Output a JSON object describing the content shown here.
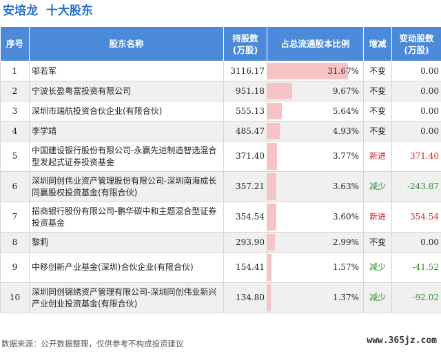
{
  "header": {
    "company": "安培龙",
    "subtitle": "十大股东"
  },
  "columns": {
    "index": "序号",
    "name": "股东名称",
    "shares_l1": "持股数",
    "shares_l2": "(万股)",
    "ratio": "占总流通股本比例",
    "change": "增减",
    "delta_l1": "变动股数",
    "delta_l2": "(万股)"
  },
  "rows": [
    {
      "index": "1",
      "name": "邬若军",
      "shares": "3116.17",
      "ratio_text": "31.67%",
      "ratio": 31.67,
      "change": "不变",
      "change_type": "same",
      "delta": "0.00"
    },
    {
      "index": "2",
      "name": "宁波长盈粤富投资有限公司",
      "shares": "951.18",
      "ratio_text": "9.67%",
      "ratio": 9.67,
      "change": "不变",
      "change_type": "same",
      "delta": "0.00"
    },
    {
      "index": "3",
      "name": "深圳市瑞航投资合伙企业(有限合伙)",
      "shares": "555.13",
      "ratio_text": "5.64%",
      "ratio": 5.64,
      "change": "不变",
      "change_type": "same",
      "delta": "0.00"
    },
    {
      "index": "4",
      "name": "李学靖",
      "shares": "485.47",
      "ratio_text": "4.93%",
      "ratio": 4.93,
      "change": "不变",
      "change_type": "same",
      "delta": "0.00"
    },
    {
      "index": "5",
      "name": "中国建设银行股份有限公司-永赢先进制造智选混合型发起式证券投资基金",
      "shares": "371.40",
      "ratio_text": "3.77%",
      "ratio": 3.77,
      "change": "新进",
      "change_type": "up",
      "delta": "371.40"
    },
    {
      "index": "6",
      "name": "深圳同创伟业资产管理股份有限公司-深圳南海成长同赢股权投资基金(有限合伙)",
      "shares": "357.21",
      "ratio_text": "3.63%",
      "ratio": 3.63,
      "change": "减少",
      "change_type": "down",
      "delta": "-243.87"
    },
    {
      "index": "7",
      "name": "招商银行股份有限公司-鹏华碳中和主题混合型证券投资基金",
      "shares": "354.54",
      "ratio_text": "3.60%",
      "ratio": 3.6,
      "change": "新进",
      "change_type": "up",
      "delta": "354.54"
    },
    {
      "index": "8",
      "name": "黎莉",
      "shares": "293.90",
      "ratio_text": "2.99%",
      "ratio": 2.99,
      "change": "不变",
      "change_type": "same",
      "delta": "0.00"
    },
    {
      "index": "9",
      "name": "中移创新产业基金(深圳)合伙企业(有限合伙)",
      "shares": "154.41",
      "ratio_text": "1.57%",
      "ratio": 1.57,
      "change": "减少",
      "change_type": "down",
      "delta": "-41.52"
    },
    {
      "index": "10",
      "name": "深圳同创锦绣资产管理有限公司-深圳同创伟业新兴产业创业投资基金(有限合伙)",
      "shares": "134.80",
      "ratio_text": "1.37%",
      "ratio": 1.37,
      "change": "减少",
      "change_type": "down",
      "delta": "-92.02"
    }
  ],
  "ratio_bar_max": 37.5,
  "footer": {
    "source": "数据来源：公开数据整理，仅供参考不构成投资建议",
    "site": "www.365jz.com"
  },
  "colors": {
    "header_bg": "#4a8ad8",
    "title": "#1f6fd0",
    "bar": "#f7c3c6",
    "up": "#d0262b",
    "down": "#2f8f2f"
  }
}
